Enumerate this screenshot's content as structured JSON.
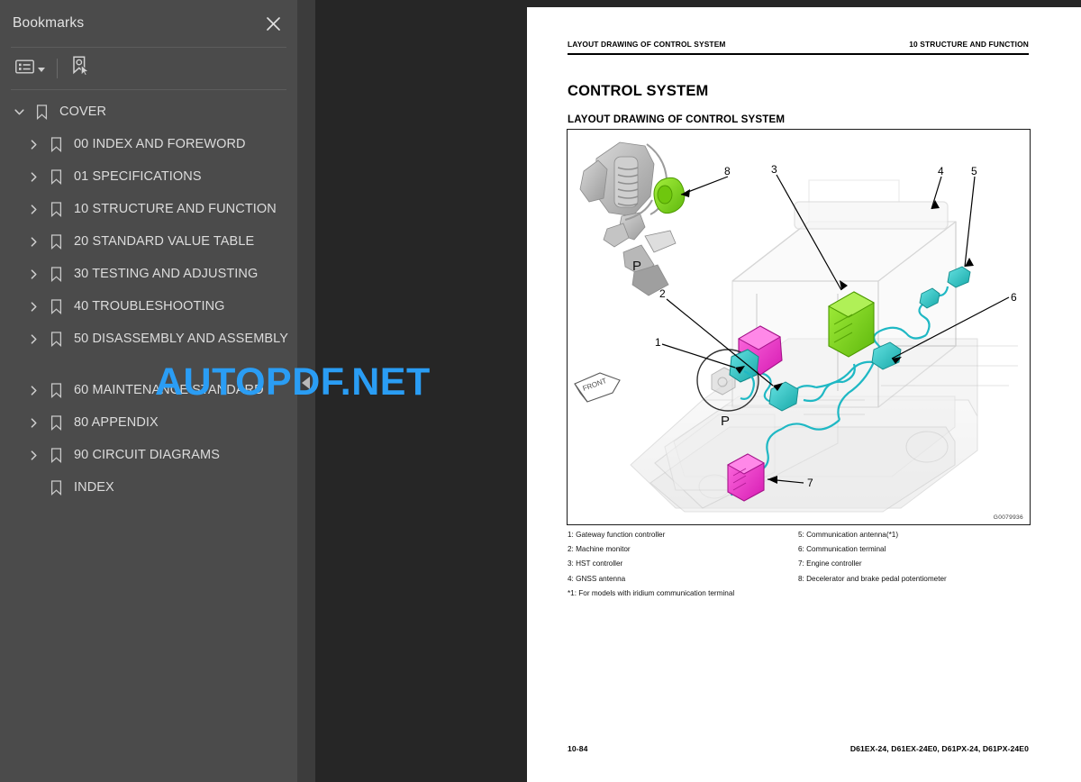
{
  "sidebar": {
    "title": "Bookmarks",
    "close_icon": "close-icon",
    "toolbar": {
      "list_options_label": "list-options-icon",
      "dropdown_caret": "chevron-down-icon",
      "bookmark_select_label": "bookmark-pointer-icon"
    },
    "items": [
      {
        "label": "COVER",
        "level": 0,
        "expanded": true,
        "has_children": true
      },
      {
        "label": "00 INDEX AND FOREWORD",
        "level": 1,
        "expanded": false,
        "has_children": true
      },
      {
        "label": "01 SPECIFICATIONS",
        "level": 1,
        "expanded": false,
        "has_children": true
      },
      {
        "label": "10 STRUCTURE AND FUNCTION",
        "level": 1,
        "expanded": false,
        "has_children": true
      },
      {
        "label": "20 STANDARD VALUE TABLE",
        "level": 1,
        "expanded": false,
        "has_children": true
      },
      {
        "label": "30 TESTING AND ADJUSTING",
        "level": 1,
        "expanded": false,
        "has_children": true
      },
      {
        "label": "40 TROUBLESHOOTING",
        "level": 1,
        "expanded": false,
        "has_children": true
      },
      {
        "label": "50 DISASSEMBLY AND ASSEMBLY",
        "level": 1,
        "expanded": false,
        "has_children": true
      },
      {
        "label": "60 MAINTENANCE STANDARD",
        "level": 1,
        "expanded": false,
        "has_children": true
      },
      {
        "label": "80 APPENDIX",
        "level": 1,
        "expanded": false,
        "has_children": true
      },
      {
        "label": "90 CIRCUIT DIAGRAMS",
        "level": 1,
        "expanded": false,
        "has_children": true
      },
      {
        "label": "INDEX",
        "level": 1,
        "expanded": false,
        "has_children": false
      }
    ]
  },
  "divider": {
    "collapse_handle_icon": "triangle-left-icon"
  },
  "document": {
    "running_head_left": "LAYOUT DRAWING OF CONTROL SYSTEM",
    "running_head_right": "10 STRUCTURE AND FUNCTION",
    "heading": "CONTROL SYSTEM",
    "subheading": "LAYOUT DRAWING OF CONTROL SYSTEM",
    "figure": {
      "id": "G0079936",
      "callout_numbers": [
        "1",
        "2",
        "3",
        "4",
        "5",
        "6",
        "7",
        "8"
      ],
      "detail_labels": [
        "P",
        "P"
      ],
      "orientation_label": "FRONT",
      "highlight_colors": {
        "green": "#7ed321",
        "magenta": "#ef2ecb",
        "cyan": "#2ec4c4"
      }
    },
    "legend_left": [
      "1: Gateway function controller",
      "2: Machine monitor",
      "3: HST controller",
      "4: GNSS antenna"
    ],
    "legend_right": [
      "5: Communication antenna(*1)",
      "6: Communication terminal",
      "7: Engine controller",
      "8: Decelerator and brake pedal potentiometer"
    ],
    "legend_note": "*1: For models with iridium communication terminal",
    "footer_left": "10-84",
    "footer_right": "D61EX-24, D61EX-24E0, D61PX-24, D61PX-24E0"
  },
  "watermark": {
    "text": "AUTOPDF.NET",
    "color": "#2a9df4"
  }
}
